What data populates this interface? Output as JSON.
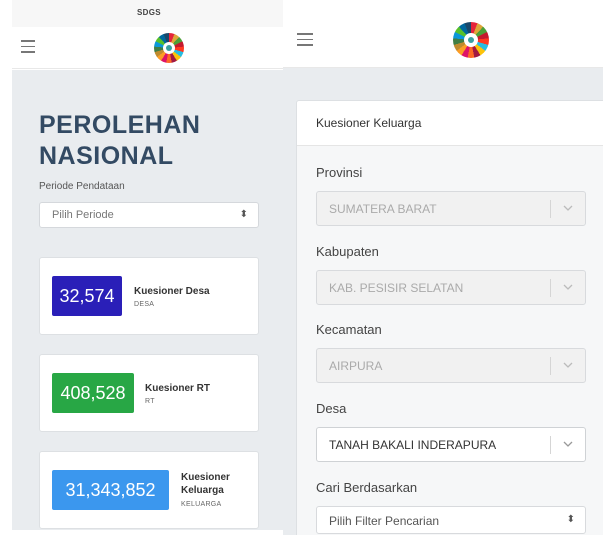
{
  "left": {
    "top_strip_label": "SDGS",
    "title": "PEROLEHAN NASIONAL",
    "periode_label": "Periode Pendataan",
    "periode_placeholder": "Pilih Periode",
    "cards": [
      {
        "value": "32,574",
        "label": "Kuesioner Desa",
        "sub": "DESA",
        "color": "#2a1fb8"
      },
      {
        "value": "408,528",
        "label": "Kuesioner RT",
        "sub": "RT",
        "color": "#28a745"
      },
      {
        "value": "31,343,852",
        "label": "Kuesioner Keluarga",
        "sub": "KELUARGA",
        "color": "#3b97ee"
      }
    ]
  },
  "right": {
    "card_title": "Kuesioner Keluarga",
    "fields": {
      "provinsi_label": "Provinsi",
      "provinsi_value": "SUMATERA BARAT",
      "kabupaten_label": "Kabupaten",
      "kabupaten_value": "KAB. PESISIR SELATAN",
      "kecamatan_label": "Kecamatan",
      "kecamatan_value": "AIRPURA",
      "desa_label": "Desa",
      "desa_value": "TANAH BAKALI INDERAPURA",
      "cari_label": "Cari Berdasarkan",
      "cari_placeholder": "Pilih Filter Pencarian"
    }
  },
  "icons": {
    "menu": "hamburger-menu-icon",
    "logo": "sdgs-wheel-logo",
    "chevron": "chevron-down-icon",
    "sort": "sort-arrows-icon"
  }
}
